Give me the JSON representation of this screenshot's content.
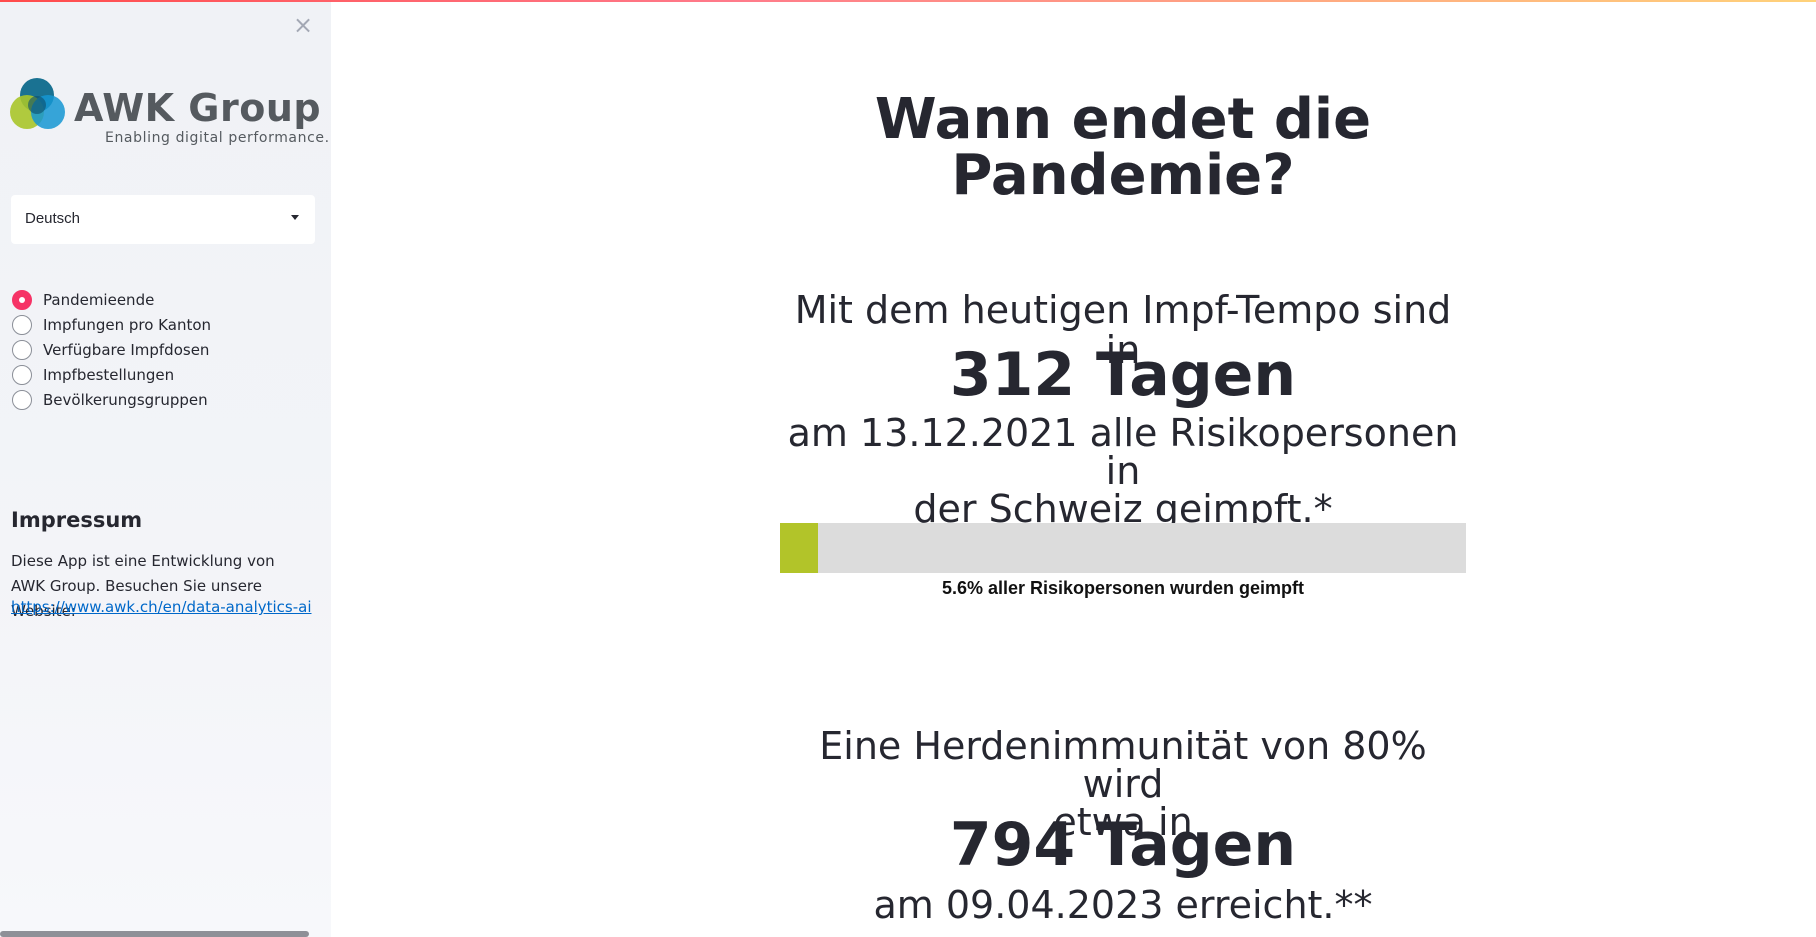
{
  "colors": {
    "accent": "#f63366",
    "progress_fill": "#b2c429",
    "progress_track": "#dcdcdc",
    "link": "#0068c9",
    "sidebar_bg": "#f0f2f6"
  },
  "sidebar": {
    "close_icon": "×",
    "logo": {
      "name": "AWK Group",
      "tagline": "Enabling digital performance."
    },
    "language_select": {
      "value": "Deutsch"
    },
    "nav": [
      {
        "label": "Pandemieende",
        "checked": true
      },
      {
        "label": "Impfungen pro Kanton",
        "checked": false
      },
      {
        "label": "Verfügbare Impfdosen",
        "checked": false
      },
      {
        "label": "Impfbestellungen",
        "checked": false
      },
      {
        "label": "Bevölkerungsgruppen",
        "checked": false
      }
    ],
    "impressum": {
      "title": "Impressum",
      "text": "Diese App ist eine Entwicklung von AWK Group. Besuchen Sie unsere Website:",
      "link": "https://www.awk.ch/en/data-analytics-ai"
    }
  },
  "main": {
    "title_line1": "Wann endet die",
    "title_line2": "Pandemie?",
    "intro": "Mit dem heutigen Impf-Tempo sind in",
    "days_risk": "312 Tagen",
    "risk_line1": "am 13.12.2021 alle Risikopersonen in",
    "risk_line2": "der Schweiz geimpft.*",
    "progress": {
      "percent": 5.6,
      "label": "5.6% aller Risikopersonen wurden geimpft"
    },
    "herd_line1": "Eine Herdenimmunität von 80% wird",
    "herd_line2": "etwa in",
    "days_herd": "794 Tagen",
    "herd_date": "am 09.04.2023 erreicht.**"
  }
}
